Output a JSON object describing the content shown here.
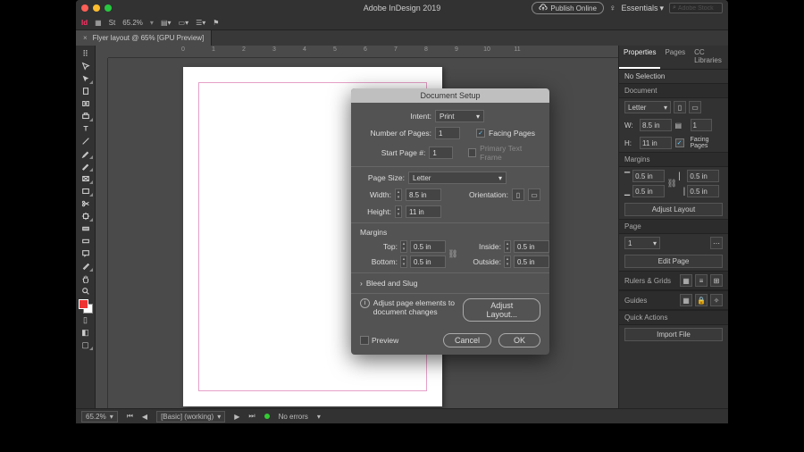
{
  "app": {
    "title": "Adobe InDesign 2019",
    "publish_label": "Publish Online",
    "workspace": "Essentials",
    "search_placeholder": "Adobe Stock",
    "zoom": "65.2%"
  },
  "doc_tab": {
    "label": "Flyer layout @ 65% [GPU Preview]"
  },
  "ruler_ticks": [
    "0",
    "1",
    "2",
    "3",
    "4",
    "5",
    "6",
    "7",
    "8",
    "9",
    "10",
    "11"
  ],
  "panels": {
    "tabs": [
      "Properties",
      "Pages",
      "CC Libraries"
    ],
    "no_selection": "No Selection",
    "document_label": "Document",
    "page_preset": "Letter",
    "w_label": "W:",
    "w_value": "8.5 in",
    "h_label": "H:",
    "h_value": "11 in",
    "pages_value": "1",
    "facing_pages": "Facing Pages",
    "margins_label": "Margins",
    "m_top": "0.5 in",
    "m_bottom": "0.5 in",
    "m_left": "0.5 in",
    "m_right": "0.5 in",
    "adjust_layout": "Adjust Layout",
    "page_label": "Page",
    "page_num": "1",
    "edit_page": "Edit Page",
    "rulers_grids": "Rulers & Grids",
    "guides": "Guides",
    "quick_actions": "Quick Actions",
    "import_file": "Import File"
  },
  "status": {
    "zoom": "65.2%",
    "view_mode": "[Basic] (working)",
    "errors": "No errors"
  },
  "dialog": {
    "title": "Document Setup",
    "intent_label": "Intent:",
    "intent_value": "Print",
    "num_pages_label": "Number of Pages:",
    "num_pages_value": "1",
    "start_page_label": "Start Page #:",
    "start_page_value": "1",
    "facing_pages": "Facing Pages",
    "facing_checked": true,
    "primary_tf": "Primary Text Frame",
    "primary_tf_checked": false,
    "page_size_label": "Page Size:",
    "page_size_value": "Letter",
    "width_label": "Width:",
    "width_value": "8.5 in",
    "height_label": "Height:",
    "height_value": "11 in",
    "orientation_label": "Orientation:",
    "margins_label": "Margins",
    "m_top_label": "Top:",
    "m_top": "0.5 in",
    "m_bottom_label": "Bottom:",
    "m_bottom": "0.5 in",
    "m_inside_label": "Inside:",
    "m_inside": "0.5 in",
    "m_outside_label": "Outside:",
    "m_outside": "0.5 in",
    "bleed_slug": "Bleed and Slug",
    "adjust_hint": "Adjust page elements to document changes",
    "adjust_btn": "Adjust Layout...",
    "preview": "Preview",
    "cancel": "Cancel",
    "ok": "OK"
  }
}
